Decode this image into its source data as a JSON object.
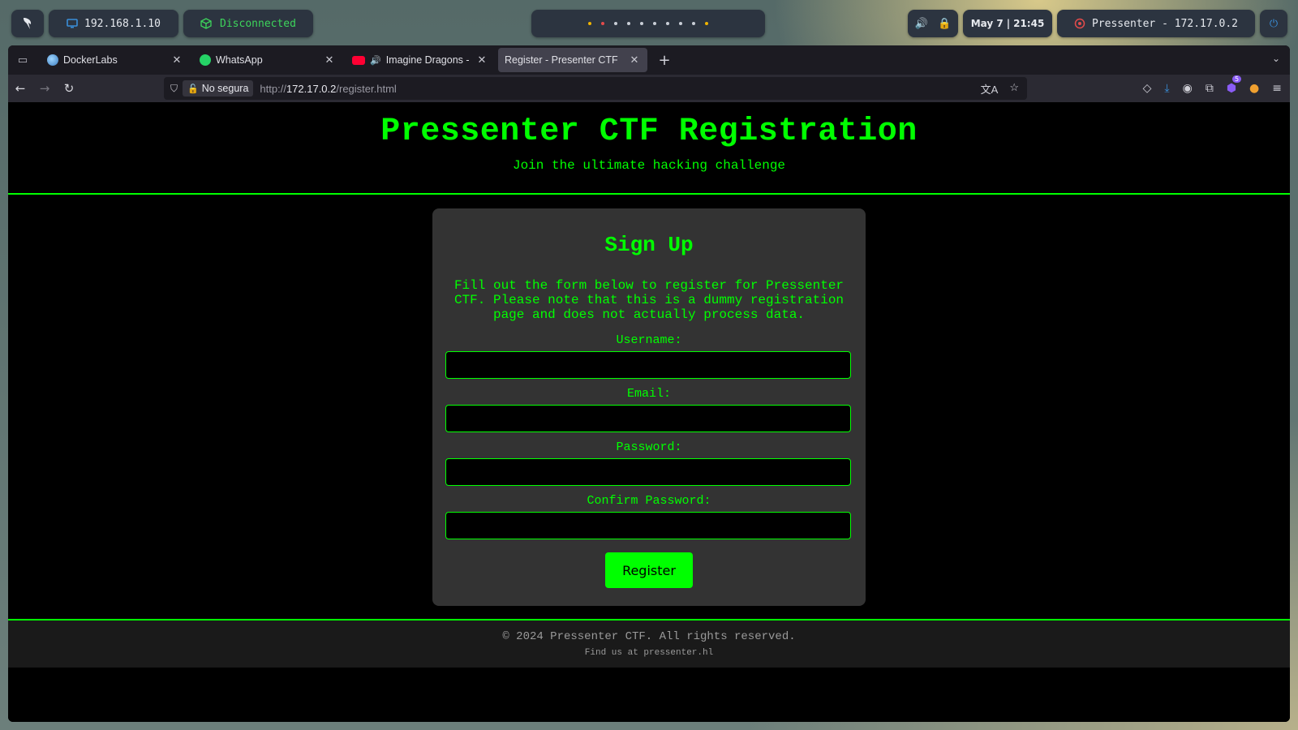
{
  "desktop": {
    "ip_address": "192.168.1.10",
    "vpn_status": "Disconnected",
    "clock": {
      "date": "May 7",
      "separator": "|",
      "time": "21:45"
    },
    "target": "Pressenter - 172.17.0.2",
    "workspace_dots": [
      "y",
      "r",
      "w",
      "w",
      "w",
      "w",
      "w",
      "w",
      "w",
      "y"
    ]
  },
  "browser": {
    "tabs": [
      {
        "title": "DockerLabs",
        "icon": "docker-favicon"
      },
      {
        "title": "WhatsApp",
        "icon": "whatsapp-favicon"
      },
      {
        "title": "Imagine Dragons - Bo",
        "icon": "youtube-favicon"
      },
      {
        "title": "Register - Presenter CTF",
        "icon": "none",
        "active": true
      }
    ],
    "security_label": "No segura",
    "url_prefix": "http://",
    "url_host": "172.17.0.2",
    "url_path": "/register.html",
    "extension_badge": "5"
  },
  "page": {
    "title": "Pressenter CTF Registration",
    "subtitle": "Join the ultimate hacking challenge",
    "form": {
      "heading": "Sign Up",
      "description": "Fill out the form below to register for Pressenter CTF. Please note that this is a dummy registration page and does not actually process data.",
      "username_label": "Username:",
      "username_value": "",
      "email_label": "Email:",
      "email_value": "",
      "password_label": "Password:",
      "password_value": "",
      "confirm_label": "Confirm Password:",
      "confirm_value": "",
      "submit_label": "Register"
    },
    "footer": {
      "copyright": "© 2024 Pressenter CTF. All rights reserved.",
      "contact": "Find us at pressenter.hl"
    }
  },
  "colors": {
    "accent": "#00ff00",
    "card": "#333333",
    "page_bg": "#000000"
  }
}
